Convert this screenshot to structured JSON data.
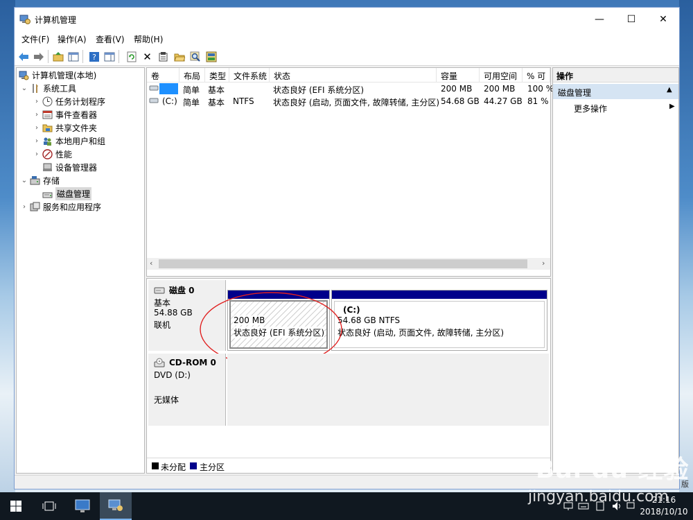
{
  "window": {
    "title": "计算机管理",
    "controls": {
      "minimize": "—",
      "maximize": "☐",
      "close": "✕"
    }
  },
  "menu": [
    "文件(F)",
    "操作(A)",
    "查看(V)",
    "帮助(H)"
  ],
  "tree": {
    "root": "计算机管理(本地)",
    "system_tools": "系统工具",
    "task_scheduler": "任务计划程序",
    "event_viewer": "事件查看器",
    "shared_folders": "共享文件夹",
    "local_users": "本地用户和组",
    "performance": "性能",
    "device_manager": "设备管理器",
    "storage": "存储",
    "disk_management": "磁盘管理",
    "services_apps": "服务和应用程序"
  },
  "volume_list": {
    "columns": [
      "卷",
      "布局",
      "类型",
      "文件系统",
      "状态",
      "容量",
      "可用空间",
      "% 可"
    ],
    "rows": [
      {
        "volume": "",
        "layout": "简单",
        "type": "基本",
        "fs": "",
        "status": "状态良好 (EFI 系统分区)",
        "capacity": "200 MB",
        "free": "200 MB",
        "pct": "100 %"
      },
      {
        "volume": "(C:)",
        "layout": "简单",
        "type": "基本",
        "fs": "NTFS",
        "status": "状态良好 (启动, 页面文件, 故障转储, 主分区)",
        "capacity": "54.68 GB",
        "free": "44.27 GB",
        "pct": "81 %"
      }
    ]
  },
  "disks": {
    "disk0": {
      "name": "磁盘 0",
      "kind": "基本",
      "size": "54.88 GB",
      "state": "联机",
      "partitions": [
        {
          "label": "",
          "size": "200 MB",
          "status": "状态良好 (EFI 系统分区)"
        },
        {
          "label": "(C:)",
          "size": "54.68 GB NTFS",
          "status": "状态良好 (启动, 页面文件, 故障转储, 主分区)"
        }
      ]
    },
    "cdrom0": {
      "name": "CD-ROM 0",
      "kind": "DVD (D:)",
      "media": "无媒体"
    }
  },
  "legend": {
    "unallocated": "未分配",
    "primary": "主分区",
    "unallocated_color": "#000000",
    "primary_color": "#00008b"
  },
  "actions": {
    "header": "操作",
    "section": "磁盘管理",
    "more": "更多操作"
  },
  "taskbar": {
    "time": "21:16",
    "date": "2018/10/10"
  },
  "watermark": {
    "logo": "Bai du 经验",
    "url": "jingyan.baidu.com",
    "side": "版"
  },
  "colors": {
    "accent": "#0078d7",
    "partition_bar": "#00008b",
    "annotation": "#e02020"
  }
}
